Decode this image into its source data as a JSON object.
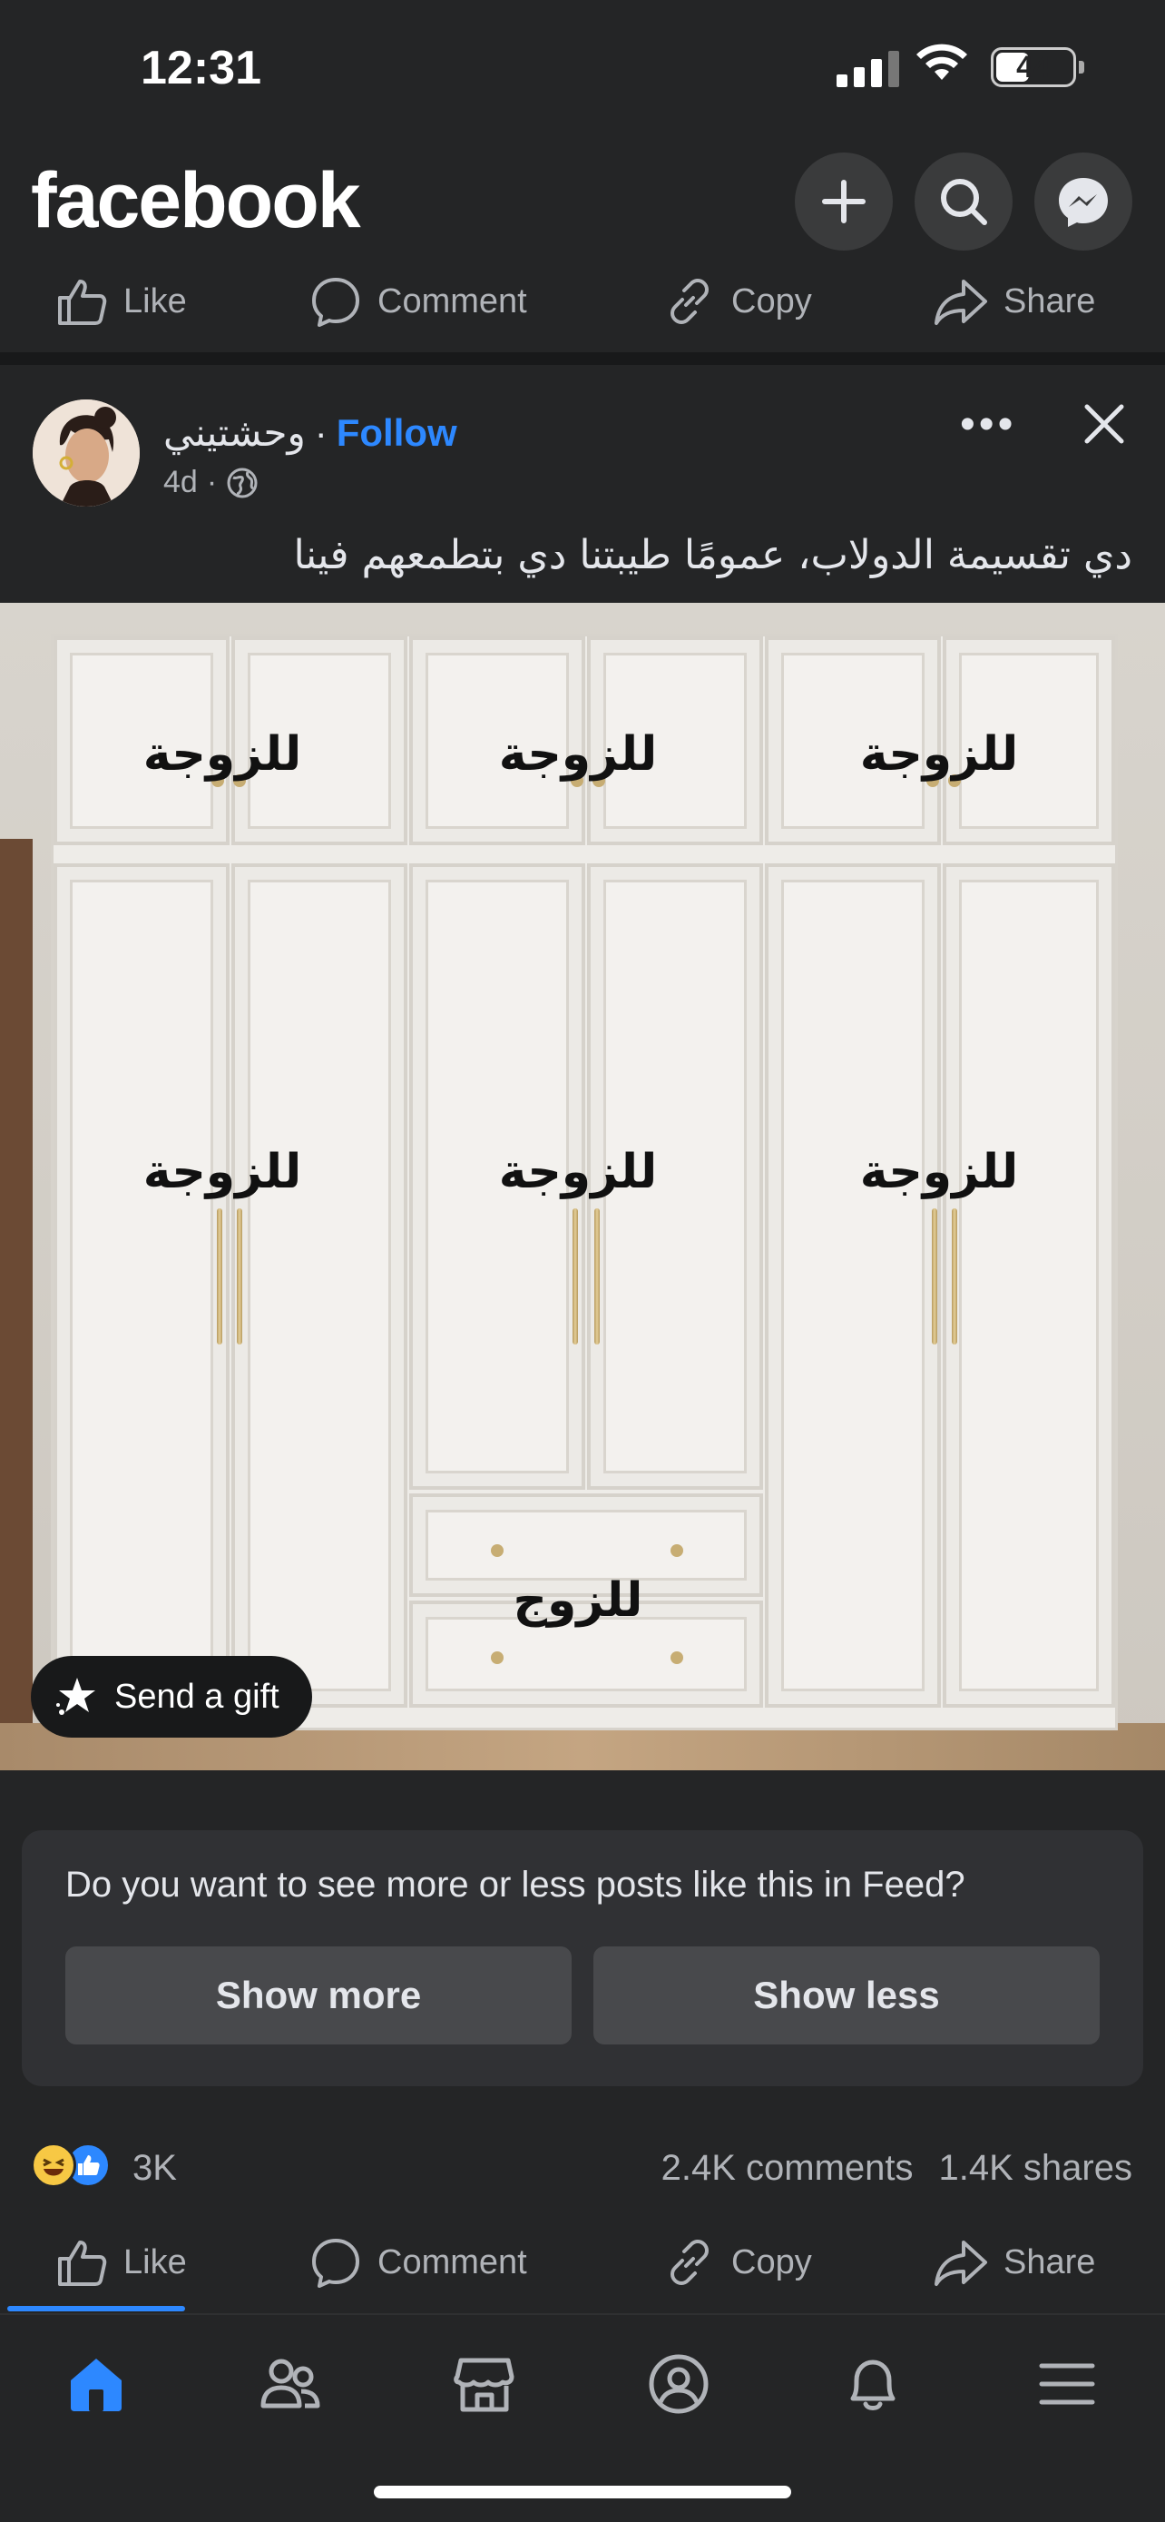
{
  "status_bar": {
    "time": "12:31",
    "battery": "44"
  },
  "header": {
    "logo": "facebook"
  },
  "actions": {
    "like": "Like",
    "comment": "Comment",
    "copy": "Copy",
    "share": "Share"
  },
  "post": {
    "author": "وحشتيني",
    "dot": "·",
    "follow": "Follow",
    "age": "4d",
    "caption": "دي تقسيمة الدولاب، عمومًا طيبتنا دي بتطمعهم فينا",
    "image_labels": {
      "top_left": "للزوجة",
      "top_mid": "للزوجة",
      "top_right": "للزوجة",
      "mid_left": "للزوجة",
      "mid_mid": "للزوجة",
      "mid_right": "للزوجة",
      "drawer": "للزوج"
    },
    "send_gift": "Send a gift"
  },
  "feedback": {
    "question": "Do you want to see more or less posts like this in Feed?",
    "show_more": "Show more",
    "show_less": "Show less"
  },
  "stats": {
    "reactions": "3K",
    "comments": "2.4K comments",
    "shares": "1.4K shares"
  },
  "bottom_tabs": [
    "home-icon",
    "friends-icon",
    "marketplace-icon",
    "profile-icon",
    "notifications-icon",
    "menu-icon"
  ],
  "colors": {
    "accent": "#2d88ff",
    "background": "#242526"
  }
}
